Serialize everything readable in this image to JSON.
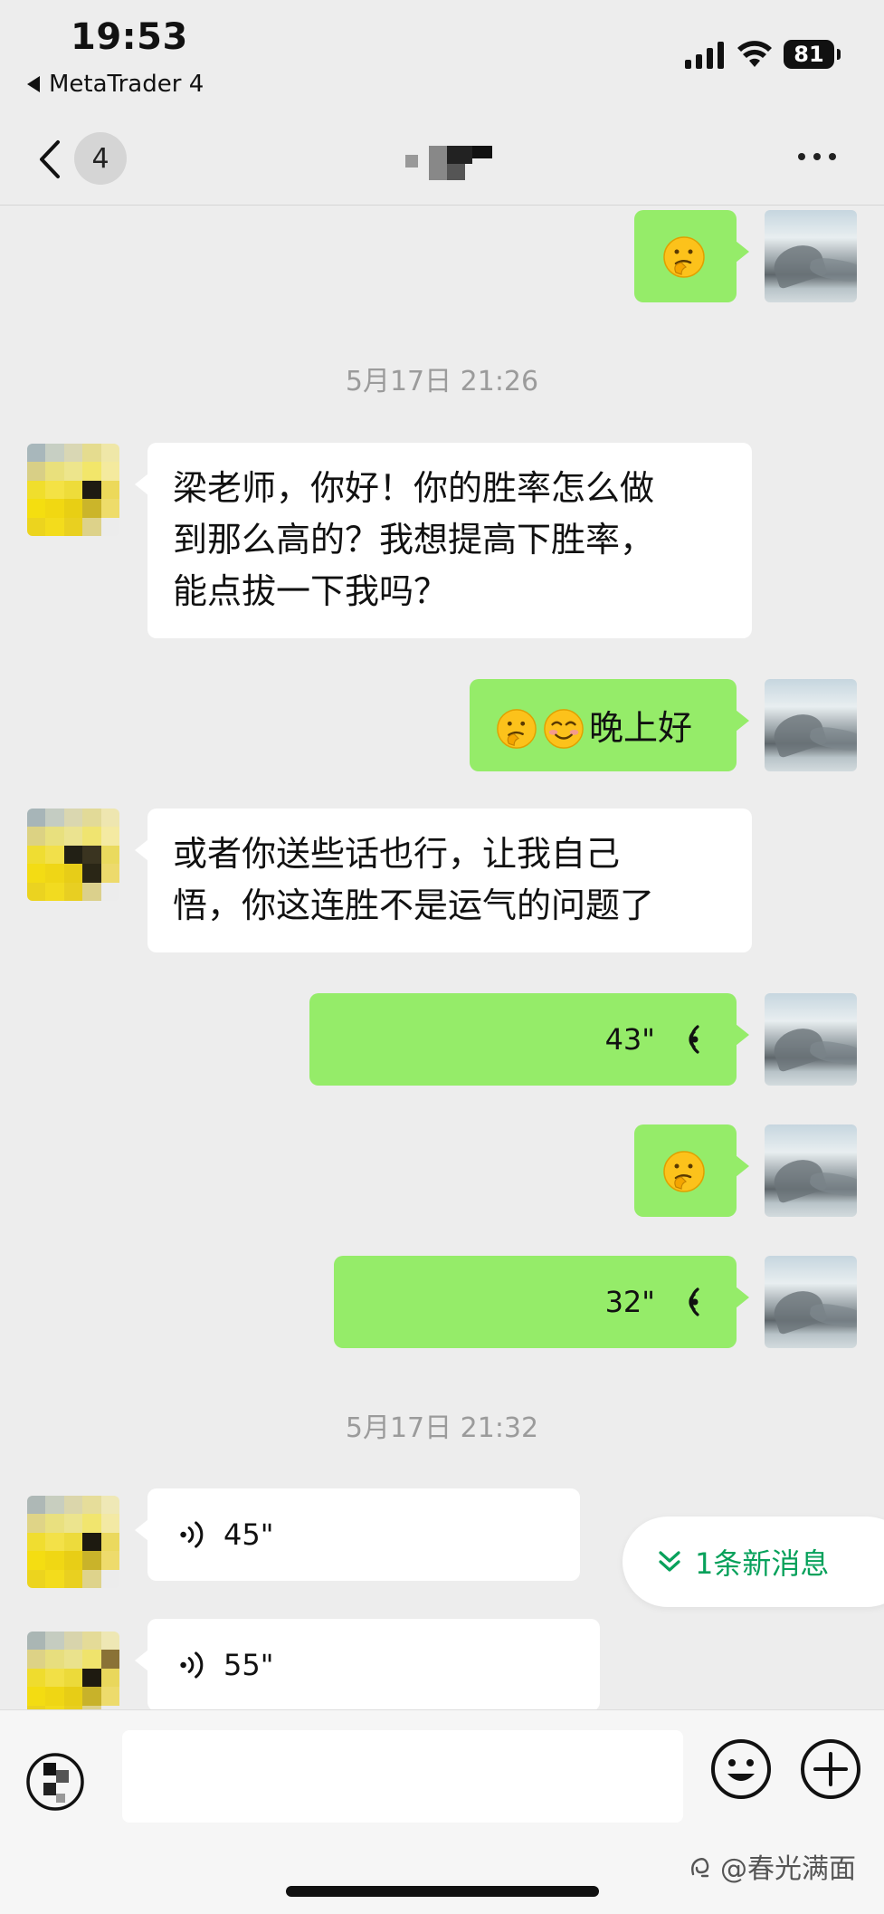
{
  "status_bar": {
    "time": "19:53",
    "back_app": "MetaTrader 4",
    "battery": "81"
  },
  "nav": {
    "unread_count": "4"
  },
  "chat": {
    "timestamps": [
      "5月17日 21:26",
      "5月17日 21:32"
    ],
    "messages": [
      {
        "text": "梁老师，你好！你的胜率怎么做到那么高的？我想提高下胜率，能点拔一下我吗？",
        "lines": [
          "梁老师，你好！你的胜率怎么做",
          "到那么高的？我想提高下胜率，",
          "能点拔一下我吗？"
        ]
      },
      {
        "text": "晚上好"
      },
      {
        "text": "或者你送些话也行，让我自己悟，你这连胜不是运气的问题了",
        "lines": [
          "或者你送些话也行，让我自己",
          "悟，你这连胜不是运气的问题了"
        ]
      },
      {
        "duration": "43\""
      },
      {
        "duration": "32\""
      },
      {
        "duration": "45\""
      },
      {
        "duration": "55\""
      }
    ],
    "new_message_hint": "1条新消息"
  },
  "watermark": "@春光满面",
  "colors": {
    "outgoing_bubble": "#95ec69",
    "incoming_bubble": "#ffffff",
    "background": "#ededed",
    "accent": "#07a15b"
  }
}
